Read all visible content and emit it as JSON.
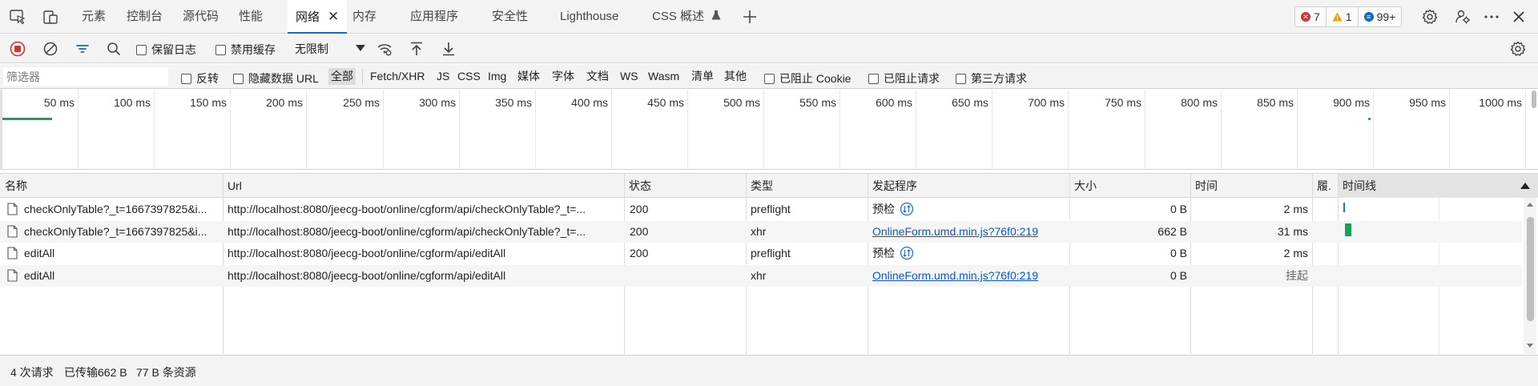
{
  "tabs": [
    {
      "label": "元素"
    },
    {
      "label": "控制台"
    },
    {
      "label": "源代码"
    },
    {
      "label": "性能"
    },
    {
      "label": "网络",
      "active": true
    },
    {
      "label": "内存"
    },
    {
      "label": "应用程序"
    },
    {
      "label": "安全性"
    },
    {
      "label": "Lighthouse"
    },
    {
      "label": "CSS 概述"
    }
  ],
  "tab_close_glyph": "✕",
  "issue_badges": {
    "errors": "7",
    "warnings": "1",
    "messages": "99+"
  },
  "toolbar": {
    "preserve_log": "保留日志",
    "disable_cache": "禁用缓存",
    "throttle": "无限制"
  },
  "filter": {
    "placeholder": "筛选器",
    "invert": "反转",
    "hide_data_urls": "隐藏数据 URL",
    "types": [
      "全部",
      "Fetch/XHR",
      "JS",
      "CSS",
      "Img",
      "媒体",
      "字体",
      "文档",
      "WS",
      "Wasm",
      "清单",
      "其他"
    ],
    "selected_type": "全部",
    "blocked_cookies": "已阻止 Cookie",
    "blocked_requests": "已阻止请求",
    "third_party": "第三方请求"
  },
  "overview": {
    "ticks": [
      "50 ms",
      "100 ms",
      "150 ms",
      "200 ms",
      "250 ms",
      "300 ms",
      "350 ms",
      "400 ms",
      "450 ms",
      "500 ms",
      "550 ms",
      "600 ms",
      "650 ms",
      "700 ms",
      "750 ms",
      "800 ms",
      "850 ms",
      "900 ms",
      "950 ms",
      "1000 ms"
    ]
  },
  "table": {
    "headers": {
      "name": "名称",
      "url": "Url",
      "status": "状态",
      "type": "类型",
      "initiator": "发起程序",
      "size": "大小",
      "time": "时间",
      "fulfilled": "履.",
      "waterfall": "时间线"
    },
    "rows": [
      {
        "name": "checkOnlyTable?_t=1667397825&i...",
        "url": "http://localhost:8080/jeecg-boot/online/cgform/api/checkOnlyTable?_t=...",
        "status": "200",
        "type": "preflight",
        "initiator": "预检",
        "initiator_is_link": false,
        "size": "0 B",
        "time": "2 ms"
      },
      {
        "name": "checkOnlyTable?_t=1667397825&i...",
        "url": "http://localhost:8080/jeecg-boot/online/cgform/api/checkOnlyTable?_t=...",
        "status": "200",
        "type": "xhr",
        "initiator": "OnlineForm.umd.min.js?76f0:219",
        "initiator_is_link": true,
        "size": "662 B",
        "time": "31 ms"
      },
      {
        "name": "editAll",
        "url": "http://localhost:8080/jeecg-boot/online/cgform/api/editAll",
        "status": "200",
        "type": "preflight",
        "initiator": "预检",
        "initiator_is_link": false,
        "size": "0 B",
        "time": "2 ms"
      },
      {
        "name": "editAll",
        "url": "http://localhost:8080/jeecg-boot/online/cgform/api/editAll",
        "status": "",
        "type": "xhr",
        "initiator": "OnlineForm.umd.min.js?76f0:219",
        "initiator_is_link": true,
        "size": "0 B",
        "time": "挂起"
      }
    ]
  },
  "status": {
    "requests": "4 次请求",
    "transferred": "已传输662 B",
    "resources": "77 B 条资源"
  },
  "colors": {
    "accent": "#0f6cbd",
    "error": "#d13438",
    "warning": "#e8a400",
    "info": "#0f6cbd",
    "record": "#d13438",
    "waterfall_green": "#17a15a",
    "waterfall_blue": "#1a73e8"
  },
  "icons": [
    "inspect-icon",
    "device-toolbar-icon",
    "plus-icon",
    "settings-icon",
    "customize-icon",
    "more-icon",
    "close-devtools-icon",
    "record-icon",
    "clear-icon",
    "filter-icon",
    "search-icon",
    "network-conditions-icon",
    "upload-icon",
    "download-icon",
    "network-settings-icon",
    "document-icon",
    "preflight-icon"
  ]
}
